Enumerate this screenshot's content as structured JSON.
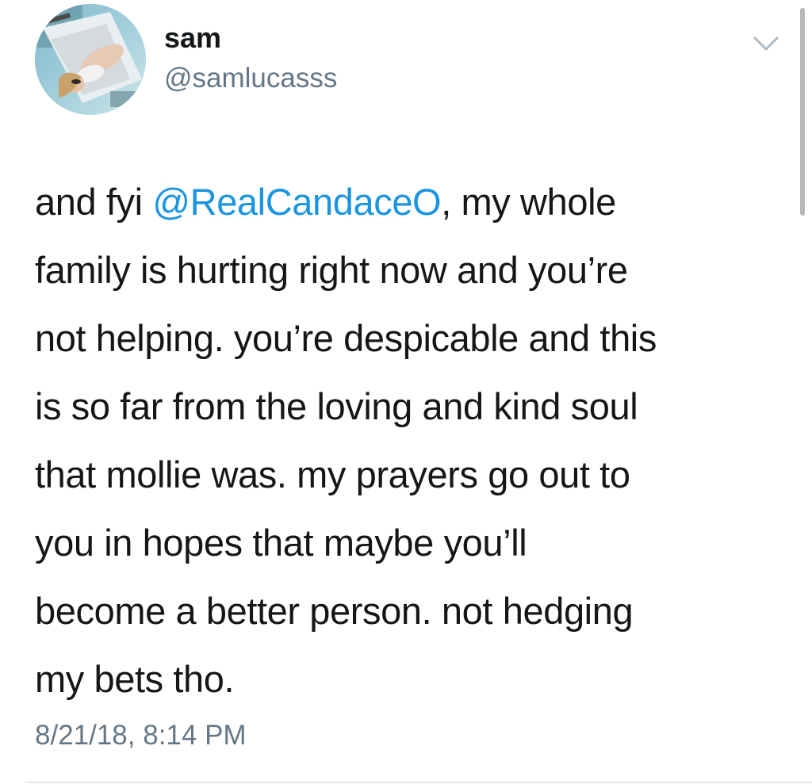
{
  "tweet": {
    "author": {
      "display_name": "sam",
      "handle": "@samlucasss"
    },
    "text": {
      "line1_before": "and fyi ",
      "mention": "@RealCandaceO",
      "line1_after": ", my whole",
      "line2": "family is hurting right now and you’re",
      "line3": "not helping. you’re despicable and this",
      "line4": "is so far from the loving and kind soul",
      "line5": "that mollie was. my prayers go out to",
      "line6": "you in hopes that maybe you’ll",
      "line7": "become a better person. not hedging",
      "line8": "my bets tho."
    },
    "timestamp": "8/21/18, 8:14 PM"
  },
  "icons": {
    "menu": "chevron-down-icon"
  },
  "colors": {
    "text": "#14171a",
    "secondary": "#657786",
    "mention": "#1b95e0"
  }
}
